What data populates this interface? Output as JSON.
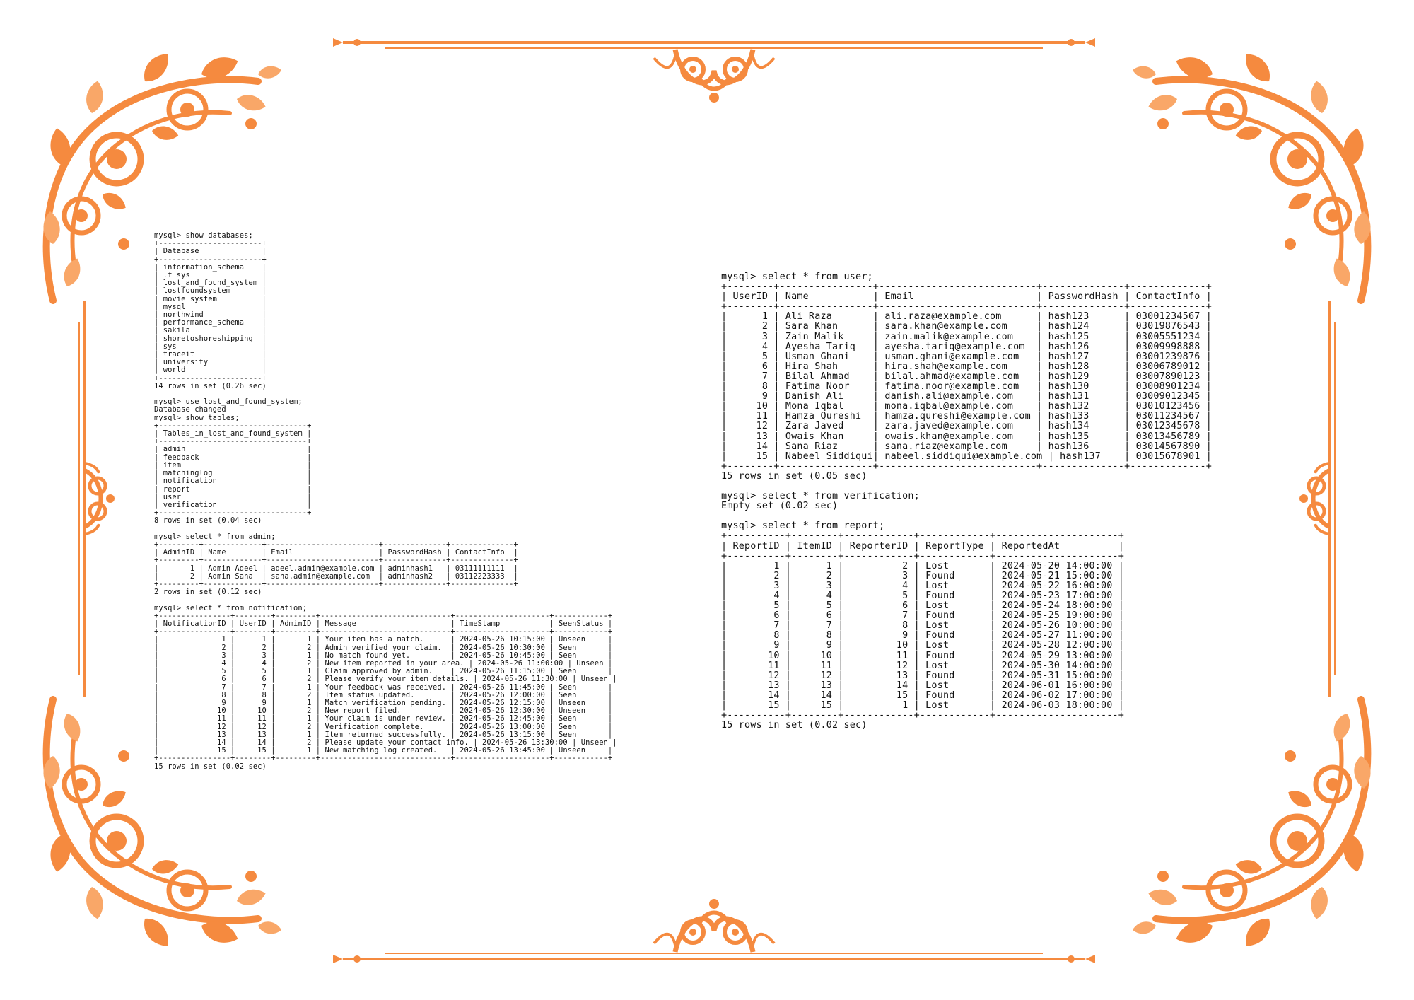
{
  "colors": {
    "ornament": "#f58a3f",
    "ornament_light": "#f9a768",
    "text": "#111111",
    "background": "#ffffff"
  },
  "icons": {
    "corner": "floral-corner-ornament",
    "top": "floral-top-divider-ornament",
    "bottom": "floral-bottom-divider-ornament",
    "side": "floral-side-ornament"
  },
  "left_terminal": {
    "lines": [
      "mysql> show databases;",
      "+-----------------------+",
      "| Database              |",
      "+-----------------------+",
      "| information_schema    |",
      "| lf_sys                |",
      "| lost_and_found_system |",
      "| lostfoundsystem       |",
      "| movie_system          |",
      "| mysql                 |",
      "| northwind             |",
      "| performance_schema    |",
      "| sakila                |",
      "| shoretoshoreshipping  |",
      "| sys                   |",
      "| traceit               |",
      "| university            |",
      "| world                 |",
      "+-----------------------+",
      "14 rows in set (0.26 sec)",
      "",
      "mysql> use lost_and_found_system;",
      "Database changed",
      "mysql> show tables;",
      "+---------------------------------+",
      "| Tables_in_lost_and_found_system |",
      "+---------------------------------+",
      "| admin                           |",
      "| feedback                        |",
      "| item                            |",
      "| matchinglog                     |",
      "| notification                    |",
      "| report                          |",
      "| user                            |",
      "| verification                    |",
      "+---------------------------------+",
      "8 rows in set (0.04 sec)",
      "",
      "mysql> select * from admin;",
      "+---------+-------------+-------------------------+--------------+--------------+",
      "| AdminID | Name        | Email                   | PasswordHash | ContactInfo  |",
      "+---------+-------------+-------------------------+--------------+--------------+",
      "|       1 | Admin Adeel | adeel.admin@example.com | adminhash1   | 03111111111  |",
      "|       2 | Admin Sana  | sana.admin@example.com  | adminhash2   | 03112223333  |",
      "+---------+-------------+-------------------------+--------------+--------------+",
      "2 rows in set (0.12 sec)",
      "",
      "mysql> select * from notification;",
      "+----------------+--------+---------+-----------------------------+---------------------+------------+",
      "| NotificationID | UserID | AdminID | Message                     | TimeStamp           | SeenStatus |",
      "+----------------+--------+---------+-----------------------------+---------------------+------------+",
      "|              1 |      1 |       1 | Your item has a match.      | 2024-05-26 10:15:00 | Unseen     |",
      "|              2 |      2 |       2 | Admin verified your claim.  | 2024-05-26 10:30:00 | Seen       |",
      "|              3 |      3 |       1 | No match found yet.         | 2024-05-26 10:45:00 | Seen       |",
      "|              4 |      4 |       2 | New item reported in your area. | 2024-05-26 11:00:00 | Unseen |",
      "|              5 |      5 |       1 | Claim approved by admin.    | 2024-05-26 11:15:00 | Seen       |",
      "|              6 |      6 |       2 | Please verify your item details. | 2024-05-26 11:30:00 | Unseen |",
      "|              7 |      7 |       1 | Your feedback was received. | 2024-05-26 11:45:00 | Seen       |",
      "|              8 |      8 |       2 | Item status updated.        | 2024-05-26 12:00:00 | Seen       |",
      "|              9 |      9 |       1 | Match verification pending. | 2024-05-26 12:15:00 | Unseen     |",
      "|             10 |     10 |       2 | New report filed.           | 2024-05-26 12:30:00 | Unseen     |",
      "|             11 |     11 |       1 | Your claim is under review. | 2024-05-26 12:45:00 | Seen       |",
      "|             12 |     12 |       2 | Verification complete.      | 2024-05-26 13:00:00 | Seen       |",
      "|             13 |     13 |       1 | Item returned successfully. | 2024-05-26 13:15:00 | Seen       |",
      "|             14 |     14 |       2 | Please update your contact info. | 2024-05-26 13:30:00 | Unseen |",
      "|             15 |     15 |       1 | New matching log created.   | 2024-05-26 13:45:00 | Unseen     |",
      "+----------------+--------+---------+-----------------------------+---------------------+------------+",
      "15 rows in set (0.02 sec)"
    ]
  },
  "right_terminal": {
    "lines": [
      "mysql> select * from user;",
      "+--------+----------------+---------------------------+--------------+-------------+",
      "| UserID | Name           | Email                     | PasswordHash | ContactInfo |",
      "+--------+----------------+---------------------------+--------------+-------------+",
      "|      1 | Ali Raza       | ali.raza@example.com      | hash123      | 03001234567 |",
      "|      2 | Sara Khan      | sara.khan@example.com     | hash124      | 03019876543 |",
      "|      3 | Zain Malik     | zain.malik@example.com    | hash125      | 03005551234 |",
      "|      4 | Ayesha Tariq   | ayesha.tariq@example.com  | hash126      | 03009998888 |",
      "|      5 | Usman Ghani    | usman.ghani@example.com   | hash127      | 03001239876 |",
      "|      6 | Hira Shah      | hira.shah@example.com     | hash128      | 03006789012 |",
      "|      7 | Bilal Ahmad    | bilal.ahmad@example.com   | hash129      | 03007890123 |",
      "|      8 | Fatima Noor    | fatima.noor@example.com   | hash130      | 03008901234 |",
      "|      9 | Danish Ali     | danish.ali@example.com    | hash131      | 03009012345 |",
      "|     10 | Mona Iqbal     | mona.iqbal@example.com    | hash132      | 03010123456 |",
      "|     11 | Hamza Qureshi  | hamza.qureshi@example.com | hash133      | 03011234567 |",
      "|     12 | Zara Javed     | zara.javed@example.com    | hash134      | 03012345678 |",
      "|     13 | Owais Khan     | owais.khan@example.com    | hash135      | 03013456789 |",
      "|     14 | Sana Riaz      | sana.riaz@example.com     | hash136      | 03014567890 |",
      "|     15 | Nabeel Siddiqui| nabeel.siddiqui@example.com | hash137    | 03015678901 |",
      "+--------+----------------+---------------------------+--------------+-------------+",
      "15 rows in set (0.05 sec)",
      "",
      "mysql> select * from verification;",
      "Empty set (0.02 sec)",
      "",
      "mysql> select * from report;",
      "+----------+--------+------------+------------+---------------------+",
      "| ReportID | ItemID | ReporterID | ReportType | ReportedAt          |",
      "+----------+--------+------------+------------+---------------------+",
      "|        1 |      1 |          2 | Lost       | 2024-05-20 14:00:00 |",
      "|        2 |      2 |          3 | Found      | 2024-05-21 15:00:00 |",
      "|        3 |      3 |          4 | Lost       | 2024-05-22 16:00:00 |",
      "|        4 |      4 |          5 | Found      | 2024-05-23 17:00:00 |",
      "|        5 |      5 |          6 | Lost       | 2024-05-24 18:00:00 |",
      "|        6 |      6 |          7 | Found      | 2024-05-25 19:00:00 |",
      "|        7 |      7 |          8 | Lost       | 2024-05-26 10:00:00 |",
      "|        8 |      8 |          9 | Found      | 2024-05-27 11:00:00 |",
      "|        9 |      9 |         10 | Lost       | 2024-05-28 12:00:00 |",
      "|       10 |     10 |         11 | Found      | 2024-05-29 13:00:00 |",
      "|       11 |     11 |         12 | Lost       | 2024-05-30 14:00:00 |",
      "|       12 |     12 |         13 | Found      | 2024-05-31 15:00:00 |",
      "|       13 |     13 |         14 | Lost       | 2024-06-01 16:00:00 |",
      "|       14 |     14 |         15 | Found      | 2024-06-02 17:00:00 |",
      "|       15 |     15 |          1 | Lost       | 2024-06-03 18:00:00 |",
      "+----------+--------+------------+------------+---------------------+",
      "15 rows in set (0.02 sec)"
    ]
  }
}
